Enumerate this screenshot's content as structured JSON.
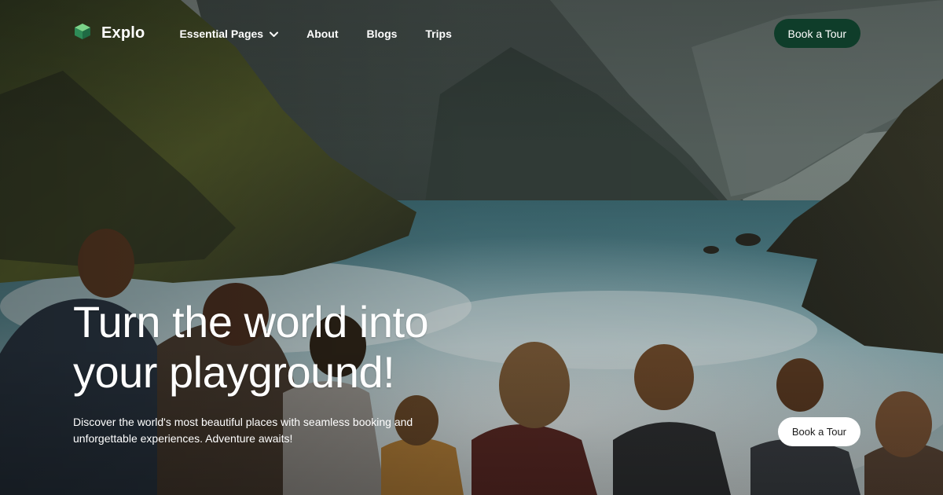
{
  "brand": {
    "name": "Explo",
    "logo_icon": "cube-icon",
    "logo_colors": [
      "#7bd389",
      "#2e8b57",
      "#1f6b44"
    ]
  },
  "nav": {
    "items": [
      {
        "label": "Essential Pages",
        "has_dropdown": true,
        "icon": "chevron-down-icon"
      },
      {
        "label": "About"
      },
      {
        "label": "Blogs"
      },
      {
        "label": "Trips"
      }
    ],
    "cta_label": "Book a Tour"
  },
  "hero": {
    "headline_line1": "Turn the world into",
    "headline_line2": "your playground!",
    "subtitle_line1": "Discover the world's most beautiful places with seamless booking and",
    "subtitle_line2": "unforgettable experiences. Adventure awaits!",
    "cta_label": "Book a Tour",
    "background": "mountain-fjord-with-group-of-hikers-photo"
  },
  "colors": {
    "accent_dark_green": "#0f3d2a",
    "text": "#ffffff",
    "button_light": "#ffffff"
  }
}
